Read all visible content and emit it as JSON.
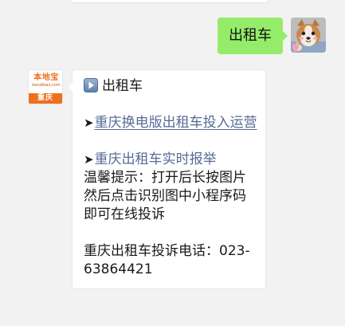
{
  "colors": {
    "background": "#f2f2f2",
    "bubble_outgoing": "#95ec69",
    "bubble_incoming": "#ffffff",
    "link": "#576b95",
    "brand_orange": "#ef6f1e"
  },
  "outgoing": {
    "text": "出租车"
  },
  "bot_avatar": {
    "logo_text": "本地宝",
    "logo_subtext": "bendibao.com",
    "city": "重庆"
  },
  "incoming": {
    "title_icon": "play-button-icon",
    "title": "出租车",
    "link1_arrow": "➤",
    "link1_text": "重庆换电版出租车投入运营",
    "link2_arrow": "➤",
    "link2_text": "重庆出租车实时报举",
    "tip_text": "温馨提示：打开后长按图片然后点击识别图中小程序码即可在线投诉",
    "phone_text": "重庆出租车投诉电话：023-63864421"
  }
}
